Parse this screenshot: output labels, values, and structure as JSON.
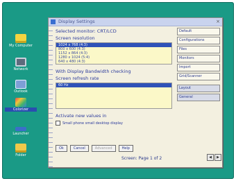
{
  "desktop": {
    "icons": [
      {
        "label": "My Computer",
        "icon": "folder-icon"
      },
      {
        "label": "Network",
        "icon": "computer-icon"
      },
      {
        "label": "Outlook",
        "icon": "mail-icon"
      },
      {
        "label": "Colorizer",
        "icon": "color-palette-icon"
      },
      {
        "label": "Launcher",
        "icon": "taskbar-icon"
      },
      {
        "label": "Folder",
        "icon": "folder-icon"
      }
    ]
  },
  "window": {
    "title": "Display Settings",
    "monitor_heading": "Selected monitor: CRT/LCD",
    "resolution_heading": "Screen resolution",
    "resolutions": [
      {
        "label": "1024 x 768 (4:3)",
        "selected": true
      },
      {
        "label": "800 x 600 (4:3)",
        "selected": false
      },
      {
        "label": "1152 x 864 (4:3)",
        "selected": false
      },
      {
        "label": "1280 x 1024 (5:4)",
        "selected": false
      },
      {
        "label": "640 x 480 (4:3)",
        "selected": false
      }
    ],
    "refresh_note": "With Display Bandwidth checking",
    "refresh_heading": "Screen refresh rate",
    "refresh_rates": [
      {
        "label": "60 Hz",
        "selected": true
      },
      {
        "label": "",
        "selected": false
      },
      {
        "label": "",
        "selected": false
      },
      {
        "label": "",
        "selected": false
      },
      {
        "label": "",
        "selected": false
      },
      {
        "label": "",
        "selected": false
      }
    ],
    "apply_heading": "Activate new values in",
    "check_label": "Small phone small desktop display",
    "buttons": {
      "ok": "Ok",
      "cancel": "Cancel",
      "disabled": "Advanced",
      "help": "Help"
    },
    "status": "Screen: Page 1 of 2",
    "spin": {
      "down": "◀",
      "up": "▶"
    }
  },
  "sidebar": {
    "items": [
      {
        "label": "Default",
        "sub": false
      },
      {
        "label": "Configurations",
        "sub": false
      },
      {
        "label": "Files",
        "sub": false
      },
      {
        "label": "Monitors",
        "sub": false
      },
      {
        "label": "Import",
        "sub": false
      },
      {
        "label": "Grid/Scanner",
        "sub": false
      },
      {
        "label": "Layout",
        "sub": true
      },
      {
        "label": "General",
        "sub": true
      }
    ]
  }
}
